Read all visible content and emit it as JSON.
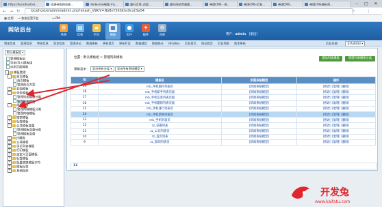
{
  "browser": {
    "tabs": [
      {
        "label": "https://localhost/e/..."
      },
      {
        "label": "搭建帝国网站图..."
      },
      {
        "label": "dedecms帝国cms..."
      },
      {
        "label": "盛行文章_百度..."
      },
      {
        "label": "盛行网站完美版..."
      },
      {
        "label": "帝国CMS - 帕..."
      },
      {
        "label": "帝国CMS-后台..."
      },
      {
        "label": "帝国CMS..."
      },
      {
        "label": "帝国CMS源码资..."
      }
    ],
    "url": "localhost/e/admin/admin.php?ehash_V9KiV=NbBnY5K0jthy9cuC9a54",
    "bookmarks": [
      "应用",
      "依依运营平台",
      "PM"
    ]
  },
  "header": {
    "logo": "网站后台",
    "nav": [
      {
        "label": "系统",
        "icon": "gear-icon"
      },
      {
        "label": "信息",
        "icon": "document-icon"
      },
      {
        "label": "栏目",
        "icon": "folder-icon"
      },
      {
        "label": "模板",
        "icon": "template-icon"
      },
      {
        "label": "用户",
        "icon": "user-icon"
      },
      {
        "label": "插件",
        "icon": "plugin-icon"
      },
      {
        "label": "其他",
        "icon": "gear-icon"
      }
    ],
    "user_label": "用户：",
    "user_name": "admin",
    "logout": "[退出]"
  },
  "subnav": {
    "items": [
      "增加信息",
      "管理信息",
      "审核信息",
      "签发信息",
      "管理评论",
      "数据更新",
      "更新首页",
      "更新栏目",
      "数据通信",
      "数据统计",
      "排行统计",
      "后台首页",
      "网站首页",
      "后台地图",
      "版本更新"
    ],
    "bg_label": "后台风格:",
    "bg_value": "主色调(绿)"
  },
  "sidebar": {
    "items": [
      {
        "label": "默认模板组"
      },
      {
        "label": "管理模板组"
      },
      {
        "label": "导出/导入模板组"
      },
      {
        "label": "动态页面模板"
      },
      {
        "label": "模板管理"
      },
      {
        "label": "首页模板"
      },
      {
        "label": "首页模板"
      },
      {
        "label": "管理首页方案"
      },
      {
        "label": "封面模板"
      },
      {
        "label": "列表模板"
      },
      {
        "label": "管理列表模板分类"
      },
      {
        "label": "管理列表模板"
      },
      {
        "label": "内容模板"
      },
      {
        "label": "管理内容模板分类"
      },
      {
        "label": "管理内容模板"
      },
      {
        "label": "搜索模板"
      },
      {
        "label": "标签模板"
      },
      {
        "label": "公共模板变量"
      },
      {
        "label": "管理模板变量分类"
      },
      {
        "label": "管理模板变量"
      },
      {
        "label": "JS模板"
      },
      {
        "label": "公共模板"
      },
      {
        "label": "评论列表模板"
      },
      {
        "label": "打印模板"
      },
      {
        "label": "自定义页面模板"
      },
      {
        "label": "标签模板"
      },
      {
        "label": "批量替换模板字符"
      },
      {
        "label": "模板标签"
      },
      {
        "label": "其他相关"
      }
    ]
  },
  "main": {
    "breadcrumb": "位置：默认模板组 > 管理列表模板",
    "btn_add": "增加列表模板",
    "btn_manage": "管理列表模板分类",
    "filter_label": "限制显示：",
    "filter_select1": "显示所有分类",
    "filter_select2": "显示所有系统模型",
    "columns": [
      "ID",
      "模板名",
      "所属系统模型",
      "操作"
    ],
    "rows": [
      {
        "id": "19",
        "name": "mb_手机图片列表页",
        "model": "[新闻系统模型]",
        "ops": "[修改] [复制] [删除]"
      },
      {
        "id": "18",
        "name": "mb_手机新手列表页面",
        "model": "[新闻系统模型]",
        "ops": "[修改] [复制] [删除]"
      },
      {
        "id": "17",
        "name": "mb_手机信息列表页面",
        "model": "[新闻系统模型]",
        "ops": "[修改] [复制] [删除]"
      },
      {
        "id": "16",
        "name": "mb_手机最新列表页面",
        "model": "[新闻系统模型]",
        "ops": "[修改] [复制] [删除]"
      },
      {
        "id": "15",
        "name": "mb_手机排行列表页",
        "model": "[新闻系统模型]",
        "ops": "[修改] [复制] [删除]"
      },
      {
        "id": "14",
        "name": "mb_手机新闻列表页",
        "model": "[新闻系统模型]",
        "ops": "[修改] [复制] [删除]"
      },
      {
        "id": "13",
        "name": "mb_手机列表页",
        "model": "[新闻系统模型]",
        "ops": "[修改] [复制] [删除]"
      },
      {
        "id": "12",
        "name": "zz_花瓣列表",
        "model": "[新闻系统模型]",
        "ops": "[修改] [复制] [删除]"
      },
      {
        "id": "11",
        "name": "zz_公司列表页",
        "model": "[新闻系统模型]",
        "ops": "[修改] [复制] [删除]"
      },
      {
        "id": "10",
        "name": "zz_首页列表",
        "model": "[新闻系统模型]",
        "ops": "[修改] [复制] [删除]"
      },
      {
        "id": "9",
        "name": "zz_新闻列表页",
        "model": "[新闻系统模型]",
        "ops": "[修改] [复制] [删除]"
      }
    ],
    "pager_text": "11"
  },
  "watermark": {
    "text": "开发兔",
    "sub": "www.kaifatu.com"
  },
  "colors": {
    "header": "#1e5ea3",
    "highlight_row": "#b9d8f2",
    "arrow": "#e0262c",
    "green_btn": "#4d9a3b"
  }
}
